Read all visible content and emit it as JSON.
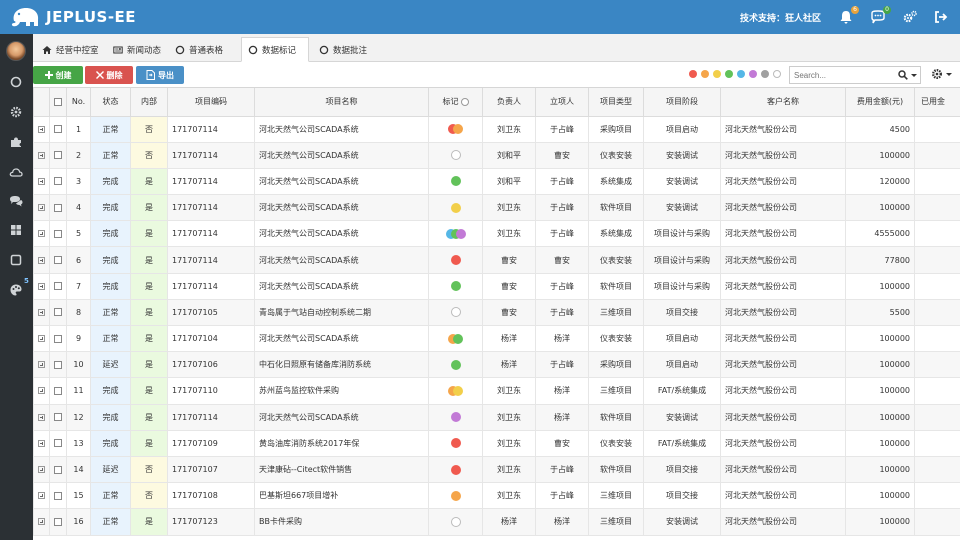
{
  "header": {
    "app_title": "JEPLUS-EE",
    "support_text": "技术支持：狂人社区",
    "notification_count": "6",
    "message_count": "0"
  },
  "sidebar": {
    "badge": "5",
    "icons": [
      "circle-icon",
      "gear-icon",
      "puzzle-icon",
      "cloud-icon",
      "chat-icon",
      "grid-icon",
      "square-icon",
      "palette-icon"
    ]
  },
  "tabs": [
    {
      "label": "经营中控室",
      "icon": "home-icon",
      "active": false
    },
    {
      "label": "新闻动态",
      "icon": "newspaper-icon",
      "active": false
    },
    {
      "label": "普通表格",
      "icon": "circle-icon",
      "active": false
    },
    {
      "label": "数据标记",
      "icon": "circle-icon",
      "active": true
    },
    {
      "label": "数据批注",
      "icon": "circle-icon",
      "active": false
    }
  ],
  "toolbar": {
    "create_label": "创建",
    "delete_label": "删除",
    "export_label": "导出",
    "search_placeholder": "Search...",
    "filter_colors": [
      "#f05a4f",
      "#f5a54a",
      "#f2cf4a",
      "#62c25a",
      "#55b7e6",
      "#c27ad6",
      "#a0a0a0",
      "empty"
    ]
  },
  "colors": {
    "red": "#f05a4f",
    "orange": "#f5a54a",
    "yellow": "#f2cf4a",
    "green": "#62c25a",
    "blue": "#55b7e6",
    "purple": "#c27ad6"
  },
  "table": {
    "headers": [
      "No.",
      "状态",
      "内部",
      "项目编码",
      "项目名称",
      "标记",
      "负责人",
      "立项人",
      "项目类型",
      "项目阶段",
      "客户名称",
      "费用金额(元)",
      "已用金"
    ],
    "rows": [
      {
        "no": "1",
        "status": "正常",
        "inner": "否",
        "code": "171707114",
        "name": "河北天然气公司SCADA系统",
        "marks": [
          "#f05a4f",
          "#f5a54a"
        ],
        "owner": "刘卫东",
        "creator": "于占峰",
        "type": "采购项目",
        "stage": "项目启动",
        "customer": "河北天然气股份公司",
        "amount": "4500"
      },
      {
        "no": "2",
        "status": "正常",
        "inner": "否",
        "code": "171707114",
        "name": "河北天然气公司SCADA系统",
        "marks": [
          "empty"
        ],
        "owner": "刘和平",
        "creator": "曹安",
        "type": "仪表安装",
        "stage": "安装调试",
        "customer": "河北天然气股份公司",
        "amount": "100000"
      },
      {
        "no": "3",
        "status": "完成",
        "inner": "是",
        "code": "171707114",
        "name": "河北天然气公司SCADA系统",
        "marks": [
          "#62c25a"
        ],
        "owner": "刘和平",
        "creator": "于占峰",
        "type": "系统集成",
        "stage": "安装调试",
        "customer": "河北天然气股份公司",
        "amount": "120000"
      },
      {
        "no": "4",
        "status": "完成",
        "inner": "是",
        "code": "171707114",
        "name": "河北天然气公司SCADA系统",
        "marks": [
          "#f2cf4a"
        ],
        "owner": "刘卫东",
        "creator": "于占峰",
        "type": "软件项目",
        "stage": "安装调试",
        "customer": "河北天然气股份公司",
        "amount": "100000"
      },
      {
        "no": "5",
        "status": "完成",
        "inner": "是",
        "code": "171707114",
        "name": "河北天然气公司SCADA系统",
        "marks": [
          "#55b7e6",
          "#62c25a",
          "#c27ad6"
        ],
        "owner": "刘卫东",
        "creator": "于占峰",
        "type": "系统集成",
        "stage": "项目设计与采购",
        "customer": "河北天然气股份公司",
        "amount": "4555000"
      },
      {
        "no": "6",
        "status": "完成",
        "inner": "是",
        "code": "171707114",
        "name": "河北天然气公司SCADA系统",
        "marks": [
          "#f05a4f"
        ],
        "owner": "曹安",
        "creator": "曹安",
        "type": "仪表安装",
        "stage": "项目设计与采购",
        "customer": "河北天然气股份公司",
        "amount": "77800"
      },
      {
        "no": "7",
        "status": "完成",
        "inner": "是",
        "code": "171707114",
        "name": "河北天然气公司SCADA系统",
        "marks": [
          "#62c25a"
        ],
        "owner": "曹安",
        "creator": "于占峰",
        "type": "软件项目",
        "stage": "项目设计与采购",
        "customer": "河北天然气股份公司",
        "amount": "100000"
      },
      {
        "no": "8",
        "status": "正常",
        "inner": "是",
        "code": "171707105",
        "name": "青岛属于气站自动控制系统二期",
        "marks": [
          "empty"
        ],
        "owner": "曹安",
        "creator": "于占峰",
        "type": "三维项目",
        "stage": "项目交接",
        "customer": "河北天然气股份公司",
        "amount": "5500"
      },
      {
        "no": "9",
        "status": "正常",
        "inner": "是",
        "code": "171707104",
        "name": "河北天然气公司SCADA系统",
        "marks": [
          "#f5a54a",
          "#62c25a"
        ],
        "owner": "杨洋",
        "creator": "杨洋",
        "type": "仪表安装",
        "stage": "项目启动",
        "customer": "河北天然气股份公司",
        "amount": "100000"
      },
      {
        "no": "10",
        "status": "延迟",
        "inner": "是",
        "code": "171707106",
        "name": "中石化日照原有储备库消防系统",
        "marks": [
          "#62c25a"
        ],
        "owner": "杨洋",
        "creator": "于占峰",
        "type": "采购项目",
        "stage": "项目启动",
        "customer": "河北天然气股份公司",
        "amount": "100000"
      },
      {
        "no": "11",
        "status": "完成",
        "inner": "是",
        "code": "171707110",
        "name": "苏州蓝鸟监控软件采购",
        "marks": [
          "#f5a54a",
          "#f2cf4a"
        ],
        "owner": "刘卫东",
        "creator": "杨洋",
        "type": "三维项目",
        "stage": "FAT/系统集成",
        "customer": "河北天然气股份公司",
        "amount": "100000"
      },
      {
        "no": "12",
        "status": "完成",
        "inner": "是",
        "code": "171707114",
        "name": "河北天然气公司SCADA系统",
        "marks": [
          "#c27ad6"
        ],
        "owner": "刘卫东",
        "creator": "杨洋",
        "type": "软件项目",
        "stage": "安装调试",
        "customer": "河北天然气股份公司",
        "amount": "100000"
      },
      {
        "no": "13",
        "status": "完成",
        "inner": "是",
        "code": "171707109",
        "name": "黄岛油库消防系统2017年保",
        "marks": [
          "#f05a4f"
        ],
        "owner": "刘卫东",
        "creator": "曹安",
        "type": "仪表安装",
        "stage": "FAT/系统集成",
        "customer": "河北天然气股份公司",
        "amount": "100000"
      },
      {
        "no": "14",
        "status": "延迟",
        "inner": "否",
        "code": "171707107",
        "name": "天津康砧--Citect软件销售",
        "marks": [
          "#f05a4f"
        ],
        "owner": "刘卫东",
        "creator": "于占峰",
        "type": "软件项目",
        "stage": "项目交接",
        "customer": "河北天然气股份公司",
        "amount": "100000"
      },
      {
        "no": "15",
        "status": "正常",
        "inner": "否",
        "code": "171707108",
        "name": "巴基斯坦667项目增补",
        "marks": [
          "#f5a54a"
        ],
        "owner": "刘卫东",
        "creator": "于占峰",
        "type": "三维项目",
        "stage": "项目交接",
        "customer": "河北天然气股份公司",
        "amount": "100000"
      },
      {
        "no": "16",
        "status": "正常",
        "inner": "是",
        "code": "171707123",
        "name": "BB卡件采购",
        "marks": [
          "empty"
        ],
        "owner": "杨洋",
        "creator": "杨洋",
        "type": "三维项目",
        "stage": "安装调试",
        "customer": "河北天然气股份公司",
        "amount": "100000"
      }
    ]
  }
}
